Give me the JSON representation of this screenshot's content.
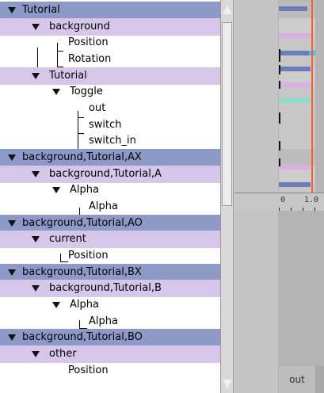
{
  "tree": {
    "rows": [
      {
        "label": "Tutorial",
        "kind": "head",
        "tri": true,
        "indent": 0
      },
      {
        "label": "background",
        "kind": "sub",
        "tri": true,
        "indent": 1
      },
      {
        "label": "Position",
        "kind": "plain",
        "tri": false,
        "indent": 2
      },
      {
        "label": "Rotation",
        "kind": "plain",
        "tri": false,
        "indent": 2
      },
      {
        "label": "Tutorial",
        "kind": "sub",
        "tri": true,
        "indent": 1
      },
      {
        "label": "Toggle",
        "kind": "plain",
        "tri": true,
        "indent": 2
      },
      {
        "label": "out",
        "kind": "plain",
        "tri": false,
        "indent": 3
      },
      {
        "label": "switch",
        "kind": "plain",
        "tri": false,
        "indent": 3
      },
      {
        "label": "switch_in",
        "kind": "plain",
        "tri": false,
        "indent": 3
      },
      {
        "label": "background,Tutorial,AX",
        "kind": "head",
        "tri": true,
        "indent": 0
      },
      {
        "label": "background,Tutorial,A",
        "kind": "sub",
        "tri": true,
        "indent": 1
      },
      {
        "label": "Alpha",
        "kind": "plain",
        "tri": true,
        "indent": 2
      },
      {
        "label": "Alpha",
        "kind": "plain",
        "tri": false,
        "indent": 3
      },
      {
        "label": "background,Tutorial,AO",
        "kind": "head",
        "tri": true,
        "indent": 0
      },
      {
        "label": "current",
        "kind": "sub",
        "tri": true,
        "indent": 1
      },
      {
        "label": "Position",
        "kind": "plain",
        "tri": false,
        "indent": 2
      },
      {
        "label": "background,Tutorial,BX",
        "kind": "head",
        "tri": true,
        "indent": 0
      },
      {
        "label": "background,Tutorial,B",
        "kind": "sub",
        "tri": true,
        "indent": 1
      },
      {
        "label": "Alpha",
        "kind": "plain",
        "tri": true,
        "indent": 2
      },
      {
        "label": "Alpha",
        "kind": "plain",
        "tri": false,
        "indent": 3
      },
      {
        "label": "background,Tutorial,BO",
        "kind": "head",
        "tri": true,
        "indent": 0
      },
      {
        "label": "other",
        "kind": "sub",
        "tri": true,
        "indent": 1
      },
      {
        "label": "Position",
        "kind": "plain",
        "tri": false,
        "indent": 2
      }
    ]
  },
  "timeline": {
    "ruler_labels": [
      "0",
      "1.0"
    ],
    "out_label": "out"
  },
  "colors": {
    "head_row": "#8d9ac8",
    "sub_row": "#d6c6e9",
    "playhead": "#ff5a30"
  },
  "icons": {
    "expander": "triangle-down-icon",
    "scroll_up": "arrow-up-icon",
    "scroll_down": "arrow-down-icon"
  }
}
